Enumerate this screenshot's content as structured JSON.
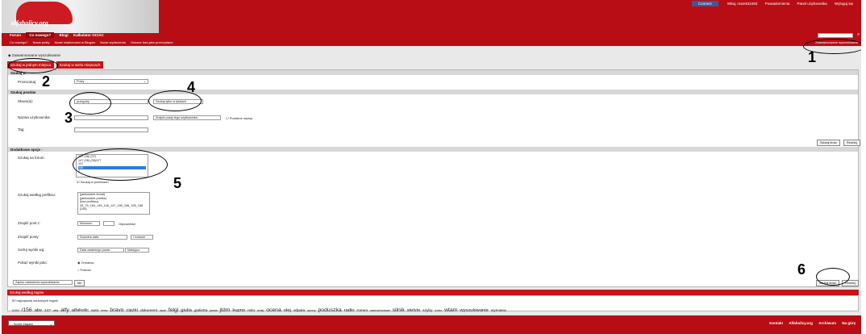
{
  "top": {
    "connect": "Connect",
    "welcome": "Witaj,",
    "user": "marek32483",
    "notifications": "Powiadomienia",
    "panel": "Panel użytkownika",
    "logout": "Wyloguj się"
  },
  "logo": {
    "text": "alfaholicy.org"
  },
  "nav": [
    {
      "label": "Forum"
    },
    {
      "label": "Co nowego?"
    },
    {
      "label": "Blogi"
    },
    {
      "label": "Kalkulator OC/AC"
    }
  ],
  "subnav": [
    {
      "label": "Co nowego?"
    },
    {
      "label": "Nowe posty"
    },
    {
      "label": "Nowe wiadomości w Blogów"
    },
    {
      "label": "Nowe wydarzenia"
    },
    {
      "label": "Oznacz fora jako przeczytane"
    }
  ],
  "search": {
    "placeholder": "",
    "saved": "Zaawansowane wyszukiwanie"
  },
  "crumb": {
    "label": "Zaawansowane wyszukiwanie"
  },
  "tabs": {
    "one": "Szukaj w jednym miejscu",
    "many": "Szukaj w wielu miejscach"
  },
  "sections": {
    "search": "Szukaj w",
    "posts": "Szukaj postów",
    "extra": "Dodatkowe opcje"
  },
  "form": {
    "search_in_label": "Przeszukaj:",
    "search_in_value": "Posty",
    "words_label": "Słowo(a):",
    "words_value": "przeguby",
    "words_mode": "Szukaj tylko w tytułach",
    "user_label": "Nazwa użytkownika:",
    "user_mode": "Znajdź posty tego użytkownika",
    "exact": "Podobne nazwy",
    "tag_label": "Tag:",
    "forum_label": "Szukaj na forum:",
    "forums": [
      "147 (06) (07)",
      "147 (06) (06)/GT",
      "147",
      "156",
      "2"
    ],
    "forum_checkbox": "Szukaj w podforach",
    "prefix_label": "Szukaj według prefiksu:",
    "prefixes": [
      "(jakikolwiek temat)",
      "(jakikolwiek prefiks)",
      "(bez prefiksu)",
      "33_75_164_145_146_147_155_156_159_166",
      "[145]"
    ],
    "posts_label": "Znajdź post z:",
    "posts_min": "Minimum",
    "posts_text": "Odpowiedzi",
    "date_label": "Znajdź posty:",
    "date_value": "Dowolna data",
    "date_dir": "I nowsze",
    "sort_label": "Sortuj wyniki wg:",
    "sort_value": "Data ostatniego posta",
    "sort_order": "Malejąco",
    "show_label": "Pokaż wyniki jako:",
    "show_topics": "Tematów",
    "show_posts": "Postów",
    "saved_label": "Zapisz ustawienia wyszukiwania",
    "go": "Idź",
    "search_button": "Szukaj teraz",
    "reset": "Resetuj"
  },
  "tags": {
    "header": "Szukaj według tagów",
    "subtitle": "50 najczęściej szukanych tagów",
    "items": [
      "#159",
      "/156",
      "abs",
      "147",
      "alfa",
      "alfy",
      "alfaholic",
      "auto",
      "bmw",
      "bravo",
      "ciężki",
      "dokument",
      "dysk",
      "felgi",
      "giulia",
      "giulietta",
      "jazda",
      "jtdm",
      "kupno",
      "mito",
      "mały",
      "ocena",
      "olej",
      "odpala",
      "opony",
      "poduszka",
      "radio",
      "romeo",
      "samochodowe",
      "silnik",
      "stelvio",
      "szyby",
      "turbo",
      "wtam",
      "wyszukiwanie",
      "wymiana"
    ]
  },
  "footer": {
    "style": "-- Sprint Zagato",
    "contact": "Kontakt",
    "site": "Alfaholicy.org",
    "archive": "Archiwum",
    "top": "Na górę"
  },
  "annotations": [
    "1",
    "2",
    "3",
    "4",
    "5",
    "6"
  ]
}
